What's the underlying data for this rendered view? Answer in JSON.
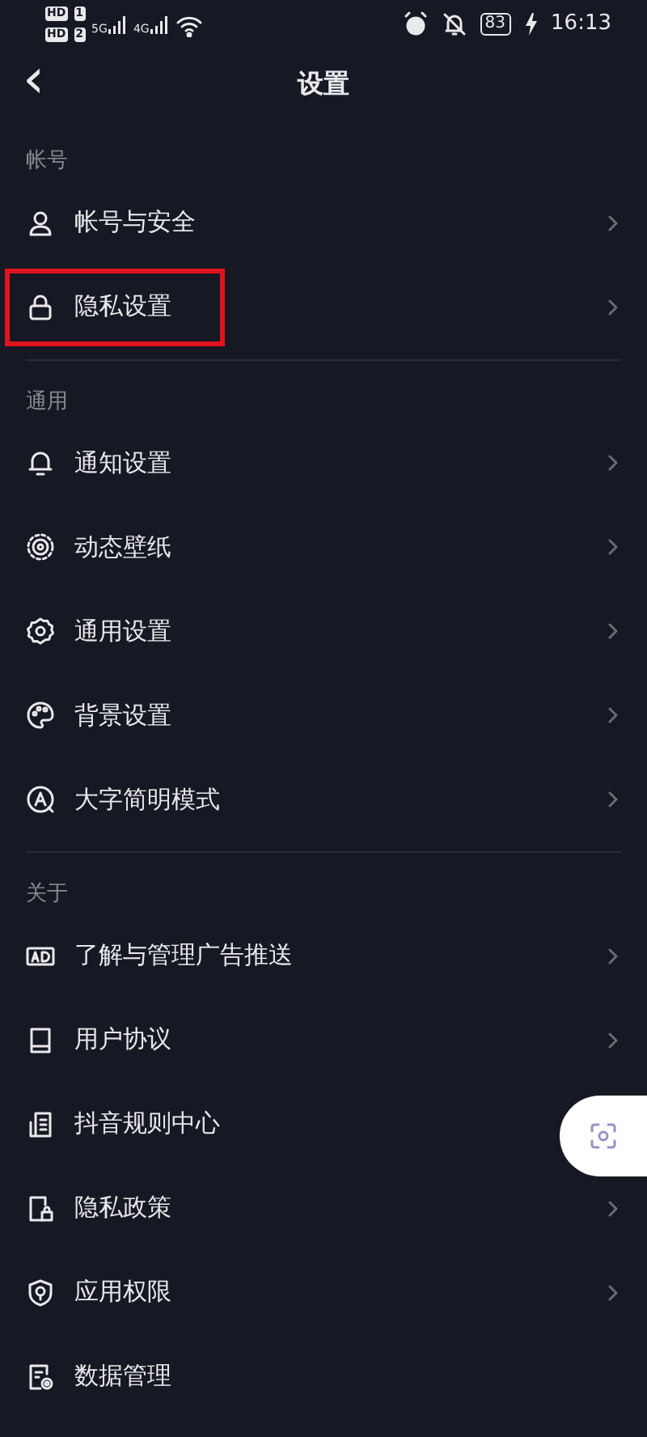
{
  "status_bar": {
    "sims": [
      {
        "hd": "HD",
        "slot": "1",
        "network": "5G"
      },
      {
        "hd": "HD",
        "slot": "2",
        "network": "4G"
      }
    ],
    "battery": "83",
    "charging": true,
    "time": "16:13"
  },
  "header": {
    "back": "‹",
    "title": "设置"
  },
  "sections": [
    {
      "label": "帐号",
      "items": [
        {
          "label": "帐号与安全",
          "chevron": true,
          "highlighted": false
        },
        {
          "label": "隐私设置",
          "chevron": true,
          "highlighted": true
        }
      ]
    },
    {
      "label": "通用",
      "items": [
        {
          "label": "通知设置",
          "chevron": true,
          "highlighted": false
        },
        {
          "label": "动态壁纸",
          "chevron": true,
          "highlighted": false
        },
        {
          "label": "通用设置",
          "chevron": true,
          "highlighted": false
        },
        {
          "label": "背景设置",
          "chevron": true,
          "highlighted": false
        },
        {
          "label": "大字简明模式",
          "chevron": true,
          "highlighted": false
        }
      ]
    },
    {
      "label": "关于",
      "items": [
        {
          "label": "了解与管理广告推送",
          "chevron": true,
          "highlighted": false
        },
        {
          "label": "用户协议",
          "chevron": true,
          "highlighted": false
        },
        {
          "label": "抖音规则中心",
          "chevron": false,
          "highlighted": false
        },
        {
          "label": "隐私政策",
          "chevron": true,
          "highlighted": false
        },
        {
          "label": "应用权限",
          "chevron": true,
          "highlighted": false
        },
        {
          "label": "数据管理",
          "chevron": false,
          "highlighted": false
        }
      ]
    }
  ]
}
